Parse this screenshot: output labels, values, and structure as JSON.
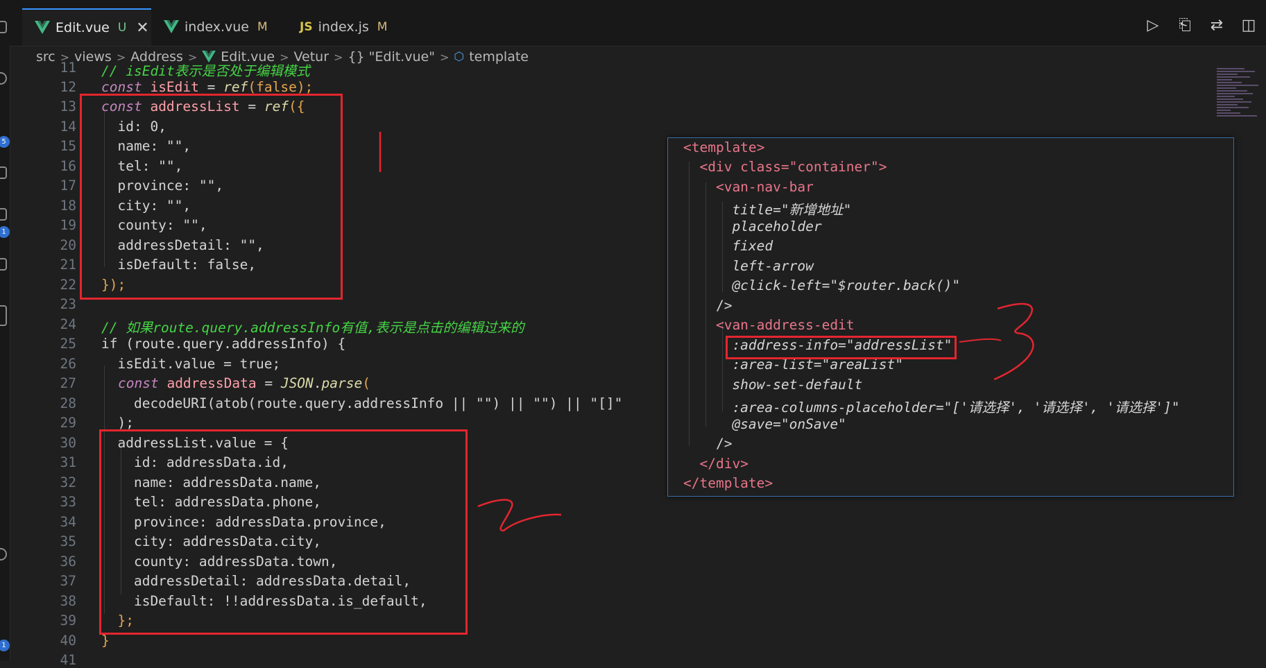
{
  "tabs": [
    {
      "name": "Edit.vue",
      "status": "U",
      "active": true,
      "icon": "vue-icon"
    },
    {
      "name": "index.vue",
      "status": "M",
      "active": false,
      "icon": "vue-icon"
    },
    {
      "name": "index.js",
      "status": "M",
      "active": false,
      "icon": "js-icon"
    }
  ],
  "tab_close": "✕",
  "js_label": "JS",
  "breadcrumb": [
    "src",
    "views",
    "Address",
    "Edit.vue",
    "Vetur",
    "{} \"Edit.vue\"",
    "template"
  ],
  "activity_badges": [
    "5",
    "1",
    "1"
  ],
  "line_numbers": [
    "11",
    "12",
    "13",
    "14",
    "15",
    "16",
    "17",
    "18",
    "19",
    "20",
    "21",
    "22",
    "23",
    "24",
    "25",
    "26",
    "27",
    "28",
    "29",
    "30",
    "31",
    "32",
    "33",
    "34",
    "35",
    "36",
    "37",
    "38",
    "39",
    "40",
    "41"
  ],
  "code": {
    "l11": "// isEdit表示是否处于编辑模式",
    "l12_kw": "const",
    "l12_var": "isEdit",
    "l12_eq": " = ",
    "l12_fn": "ref",
    "l12_rest": "(false);",
    "l13_kw": "const",
    "l13_var": "addressList",
    "l13_eq": " = ",
    "l13_fn": "ref",
    "l13_rest": "({",
    "l14": "  id: 0,",
    "l15": "  name: \"\",",
    "l16": "  tel: \"\",",
    "l17": "  province: \"\",",
    "l18": "  city: \"\",",
    "l19": "  county: \"\",",
    "l20": "  addressDetail: \"\",",
    "l21": "  isDefault: false,",
    "l22": "});",
    "l24": "// 如果route.query.addressInfo有值,表示是点击的编辑过来的",
    "l25": "if (route.query.addressInfo) {",
    "l26": "  isEdit.value = true;",
    "l27_kw": "const",
    "l27_var": "addressData",
    "l27_eq": " = ",
    "l27_obj": "JSON",
    "l27_fn": "parse",
    "l27_rest": "(",
    "l28": "    decodeURI(atob(route.query.addressInfo || \"\") || \"\") || \"[]\"",
    "l29": "  );",
    "l30": "  addressList.value = {",
    "l31": "    id: addressData.id,",
    "l32": "    name: addressData.name,",
    "l33": "    tel: addressData.phone,",
    "l34": "    province: addressData.province,",
    "l35": "    city: addressData.city,",
    "l36": "    county: addressData.town,",
    "l37": "    addressDetail: addressData.detail,",
    "l38": "    isDefault: !!addressData.is_default,",
    "l39": "  };",
    "l40": "}"
  },
  "template_popup": {
    "lines": [
      "<template>",
      "  <div class=\"container\">",
      "    <van-nav-bar",
      "      title=\"新增地址\"",
      "      placeholder",
      "      fixed",
      "      left-arrow",
      "      @click-left=\"$router.back()\"",
      "    />",
      "    <van-address-edit",
      "      :address-info=\"addressList\"",
      "      :area-list=\"areaList\"",
      "      show-set-default",
      "      :area-columns-placeholder=\"['请选择', '请选择', '请选择']\"",
      "      @save=\"onSave\"",
      "    />",
      "  </div>",
      "</template>"
    ]
  },
  "colors": {
    "annotation": "#e3262f",
    "accent": "#3794ff"
  }
}
